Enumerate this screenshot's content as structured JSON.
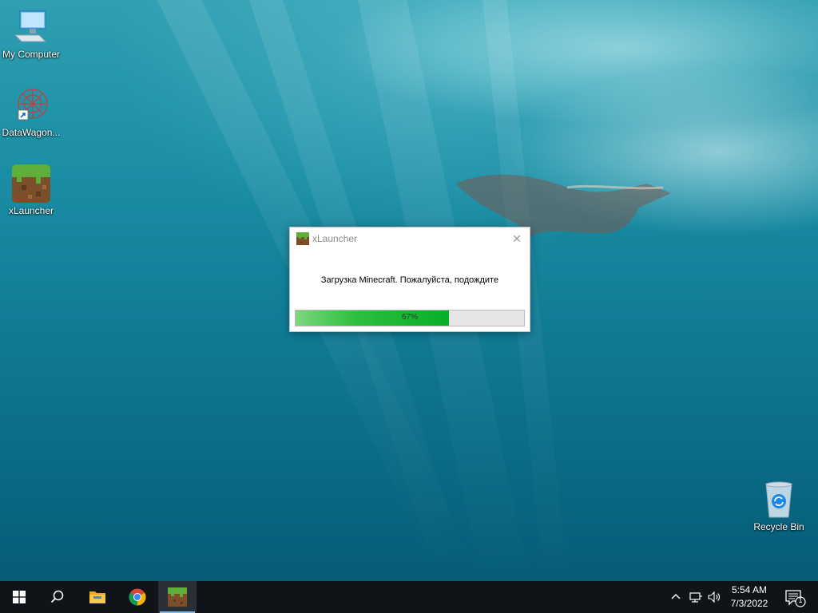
{
  "desktop": {
    "icons": [
      {
        "label": "My Computer",
        "icon": "computer-icon"
      },
      {
        "label": "DataWagon...",
        "icon": "datawagon-icon"
      },
      {
        "label": "xLauncher",
        "icon": "minecraft-grass-icon"
      },
      {
        "label": "Recycle Bin",
        "icon": "recycle-bin-icon"
      }
    ]
  },
  "dialog": {
    "title": "xLauncher",
    "message": "Загрузка Minecraft. Пожалуйста, подождите",
    "progress_label": "67%",
    "progress_fraction": 0.67,
    "close_glyph": "✕"
  },
  "taskbar": {
    "buttons": [
      "windows-start-icon",
      "search-icon",
      "file-explorer-icon",
      "chrome-icon",
      "xlauncher-icon"
    ],
    "clock": {
      "time": "5:54 AM",
      "date": "7/3/2022"
    },
    "notification_count": "1",
    "accent": "#76b9ed"
  },
  "colors": {
    "progress_green": "#06b025",
    "taskbar": "#101418"
  }
}
